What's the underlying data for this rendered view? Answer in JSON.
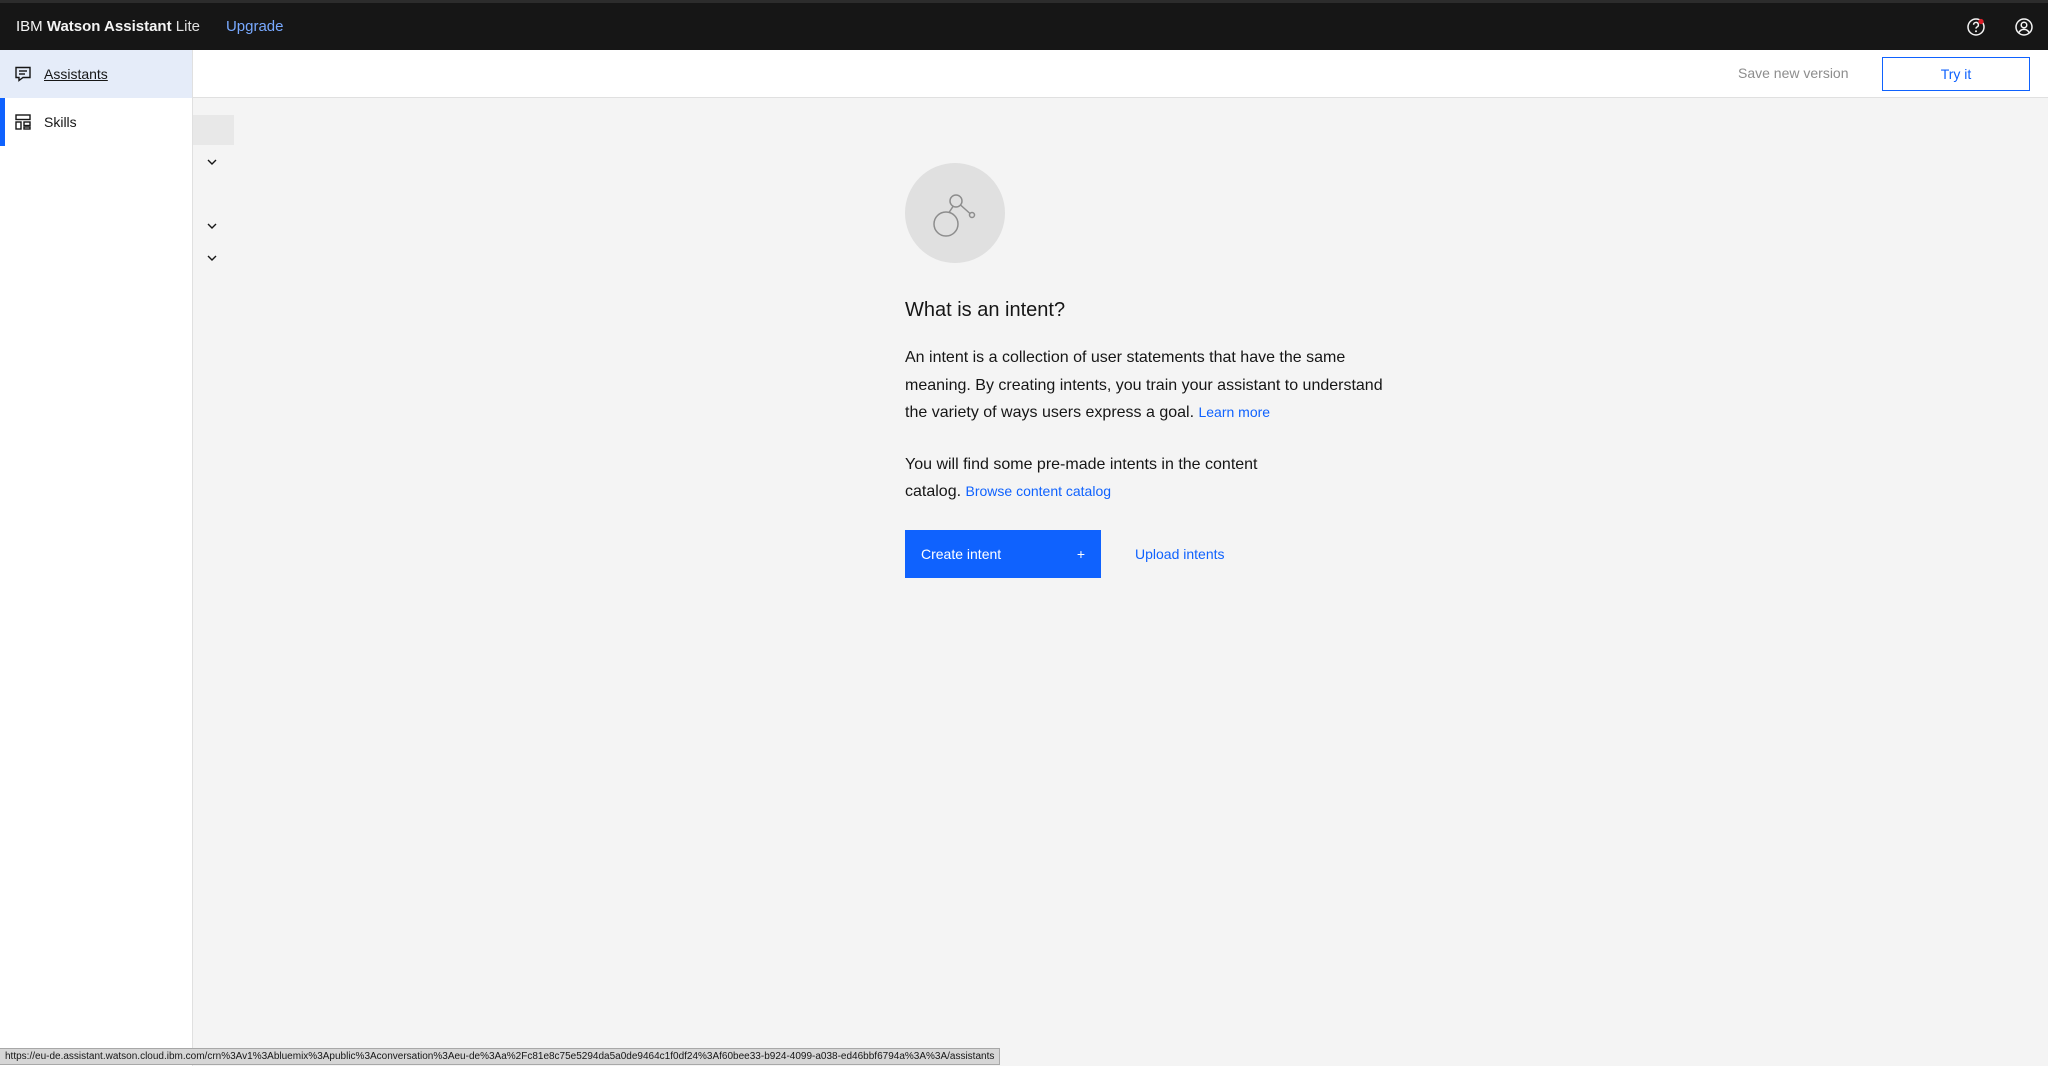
{
  "header": {
    "brand_prefix": "IBM",
    "brand_name": "Watson Assistant",
    "brand_plan": "Lite",
    "upgrade_label": "Upgrade"
  },
  "sidebar": {
    "items": [
      {
        "label": "Assistants",
        "icon": "chat-icon"
      },
      {
        "label": "Skills",
        "icon": "skills-icon"
      }
    ]
  },
  "toolbar": {
    "save_version_label": "Save new version",
    "try_it_label": "Try it"
  },
  "empty_state": {
    "title": "What is an intent?",
    "paragraph1": "An intent is a collection of user statements that have the same meaning. By creating intents, you train your assistant to understand the variety of ways users express a goal.",
    "learn_more": "Learn more",
    "paragraph2": "You will find some pre-made intents in the content catalog.",
    "browse_catalog": "Browse content catalog",
    "create_label": "Create intent",
    "create_icon": "+",
    "upload_label": "Upload intents"
  },
  "status_url": "https://eu-de.assistant.watson.cloud.ibm.com/crn%3Av1%3Abluemix%3Apublic%3Aconversation%3Aeu-de%3Aa%2Fc81e8c75e5294da5a0de9464c1f0df24%3Af60bee33-b924-4099-a038-ed46bbf6794a%3A%3A/assistants"
}
